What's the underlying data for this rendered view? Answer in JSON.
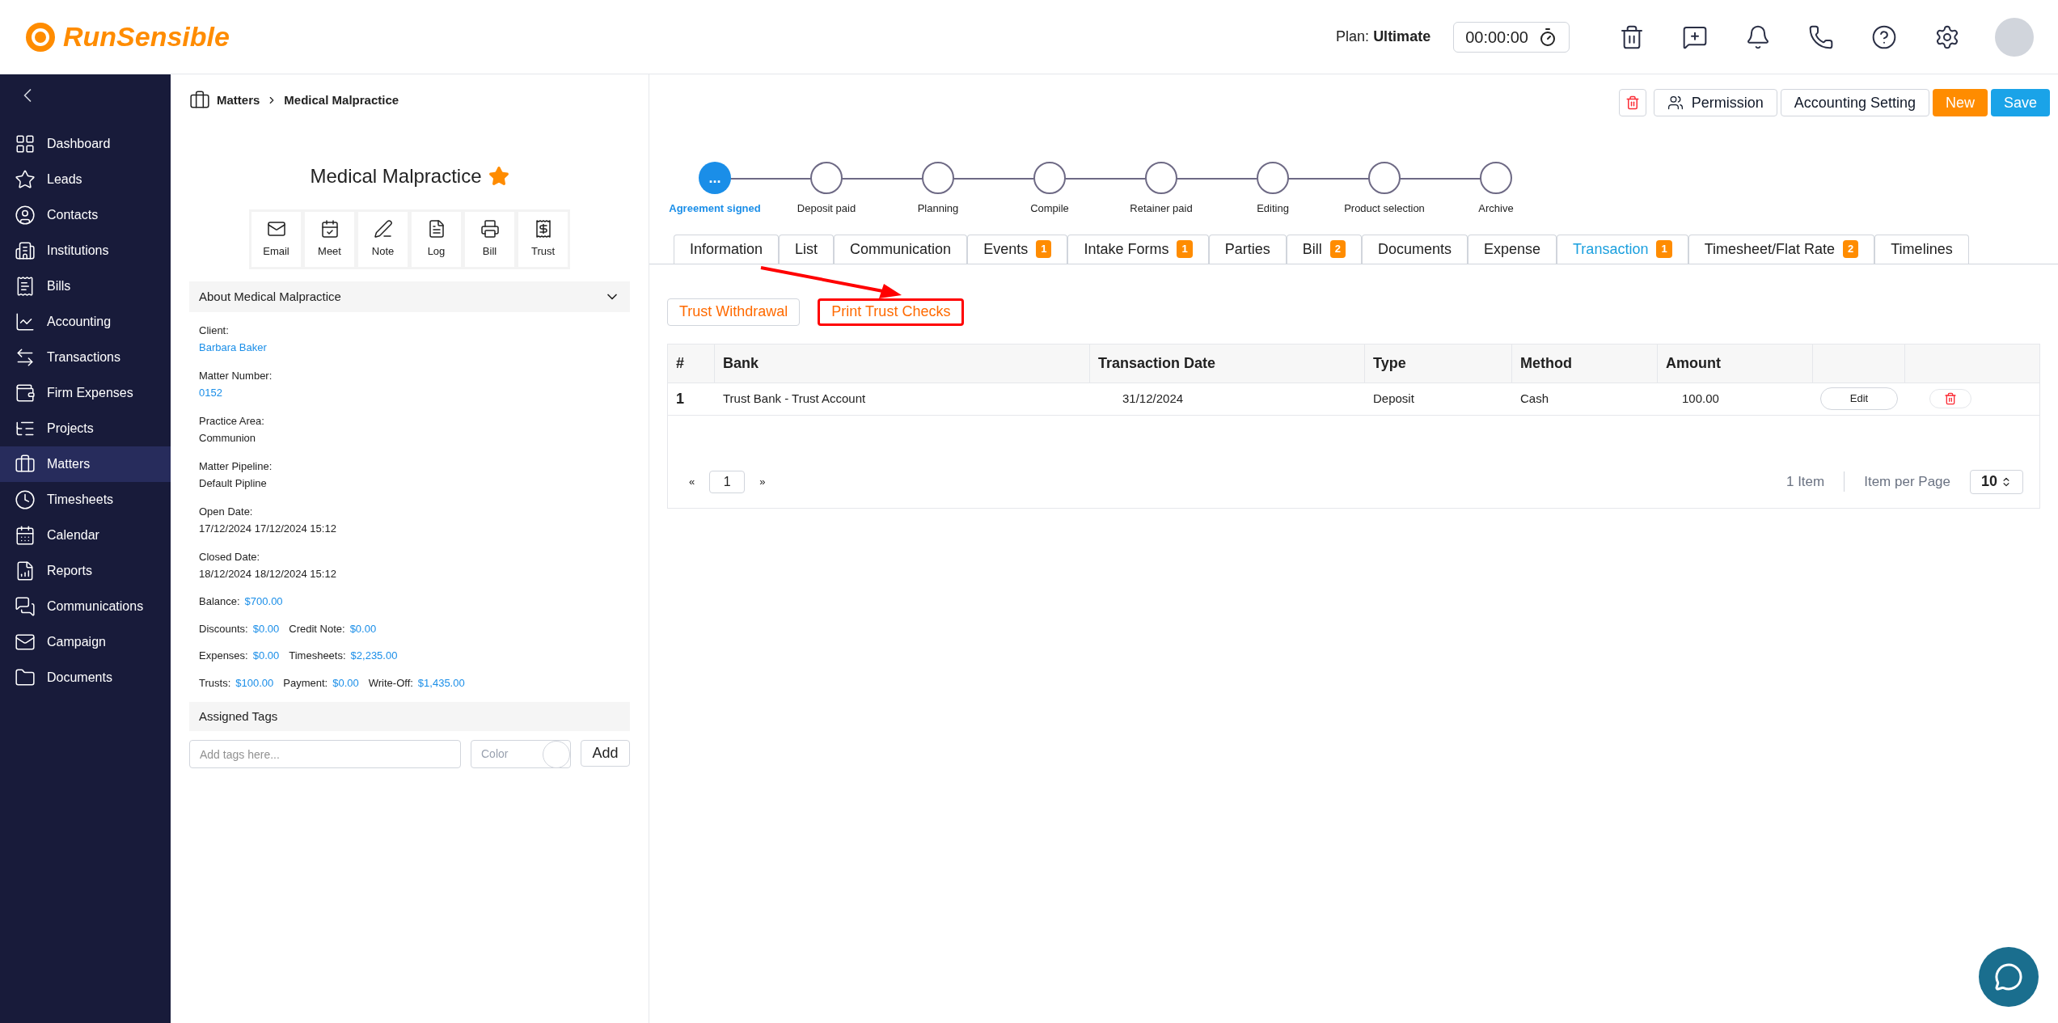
{
  "header": {
    "logo": "RunSensible",
    "plan_label": "Plan:",
    "plan_value": "Ultimate",
    "timer": "00:00:00"
  },
  "sidebar": {
    "items": [
      {
        "label": "Dashboard",
        "selected": false
      },
      {
        "label": "Leads",
        "selected": false
      },
      {
        "label": "Contacts",
        "selected": false
      },
      {
        "label": "Institutions",
        "selected": false
      },
      {
        "label": "Bills",
        "selected": false
      },
      {
        "label": "Accounting",
        "selected": false
      },
      {
        "label": "Transactions",
        "selected": false
      },
      {
        "label": "Firm Expenses",
        "selected": false
      },
      {
        "label": "Projects",
        "selected": false
      },
      {
        "label": "Matters",
        "selected": true
      },
      {
        "label": "Timesheets",
        "selected": false
      },
      {
        "label": "Calendar",
        "selected": false
      },
      {
        "label": "Reports",
        "selected": false
      },
      {
        "label": "Communications",
        "selected": false
      },
      {
        "label": "Campaign",
        "selected": false
      },
      {
        "label": "Documents",
        "selected": false
      }
    ]
  },
  "breadcrumb": [
    "Matters",
    "Medical Malpractice"
  ],
  "toolbar": {
    "buttons": [
      {
        "label": "Permission",
        "kind": "outline"
      },
      {
        "label": "Accounting Setting",
        "kind": "outline"
      },
      {
        "label": "New",
        "kind": "orange"
      },
      {
        "label": "Save",
        "kind": "blue"
      }
    ]
  },
  "matter": {
    "title": "Medical Malpractice",
    "starred": true,
    "actions": [
      "Email",
      "Meet",
      "Note",
      "Log",
      "Bill",
      "Trust"
    ],
    "about": {
      "title": "About Medical Malpractice",
      "expanded": true,
      "fields": [
        {
          "label": "Client:",
          "value": "Barbara Baker",
          "link": true
        },
        {
          "label": "Matter Number:",
          "value": "0152",
          "link": true
        },
        {
          "label": "Practice Area:",
          "value": "Communion",
          "link": false
        },
        {
          "label": "Matter Pipeline:",
          "value": "Default Pipline",
          "link": false
        },
        {
          "label": "Open Date:",
          "value": "17/12/2024 17/12/2024 15:12",
          "link": false
        },
        {
          "label": "Closed Date:",
          "value": "18/12/2024 18/12/2024 15:12",
          "link": false
        }
      ],
      "amount_rows": [
        [
          {
            "label": "Balance:",
            "value": "$700.00"
          }
        ],
        [
          {
            "label": "Discounts:",
            "value": "$0.00"
          },
          {
            "label": "Credit Note:",
            "value": "$0.00"
          }
        ],
        [
          {
            "label": "Expenses:",
            "value": "$0.00"
          },
          {
            "label": "Timesheets:",
            "value": "$2,235.00"
          }
        ],
        [
          {
            "label": "Trusts:",
            "value": "$100.00"
          },
          {
            "label": "Payment:",
            "value": "$0.00"
          },
          {
            "label": "Write-Off:",
            "value": "$1,435.00"
          }
        ]
      ]
    },
    "tags": {
      "title": "Assigned Tags",
      "placeholder": "Add tags here...",
      "color_label": "Color",
      "add": "Add"
    }
  },
  "pipeline": [
    {
      "label": "Agreement signed",
      "selected": true,
      "mark": "..."
    },
    {
      "label": "Deposit paid",
      "selected": false
    },
    {
      "label": "Planning",
      "selected": false
    },
    {
      "label": "Compile",
      "selected": false
    },
    {
      "label": "Retainer paid",
      "selected": false
    },
    {
      "label": "Editing",
      "selected": false
    },
    {
      "label": "Product selection",
      "selected": false
    },
    {
      "label": "Archive",
      "selected": false
    }
  ],
  "tabs": [
    {
      "label": "Information",
      "selected": false
    },
    {
      "label": "List",
      "selected": false
    },
    {
      "label": "Communication",
      "selected": false
    },
    {
      "label": "Events",
      "badge": "1",
      "selected": false
    },
    {
      "label": "Intake Forms",
      "badge": "1",
      "selected": false
    },
    {
      "label": "Parties",
      "selected": false
    },
    {
      "label": "Bill",
      "badge": "2",
      "selected": false
    },
    {
      "label": "Documents",
      "selected": false
    },
    {
      "label": "Expense",
      "selected": false
    },
    {
      "label": "Transaction",
      "badge": "1",
      "selected": true
    },
    {
      "label": "Timesheet/Flat Rate",
      "badge": "2",
      "selected": false
    },
    {
      "label": "Timelines",
      "selected": false
    }
  ],
  "actions": [
    {
      "label": "Trust Withdrawal",
      "highlighted": false
    },
    {
      "label": "Print Trust Checks",
      "highlighted": true
    }
  ],
  "table": {
    "columns": [
      "#",
      "Bank",
      "Transaction Date",
      "Type",
      "Method",
      "Amount"
    ],
    "rows": [
      {
        "cells": [
          "1",
          "Trust Bank - Trust Account",
          "31/12/2024",
          "Deposit",
          "Cash",
          "100.00"
        ],
        "edit": "Edit"
      }
    ]
  },
  "pagination": {
    "prev": "«",
    "page": "1",
    "next": "»",
    "count": "1 Item",
    "per_page_label": "Item per Page",
    "per_page": "10"
  }
}
